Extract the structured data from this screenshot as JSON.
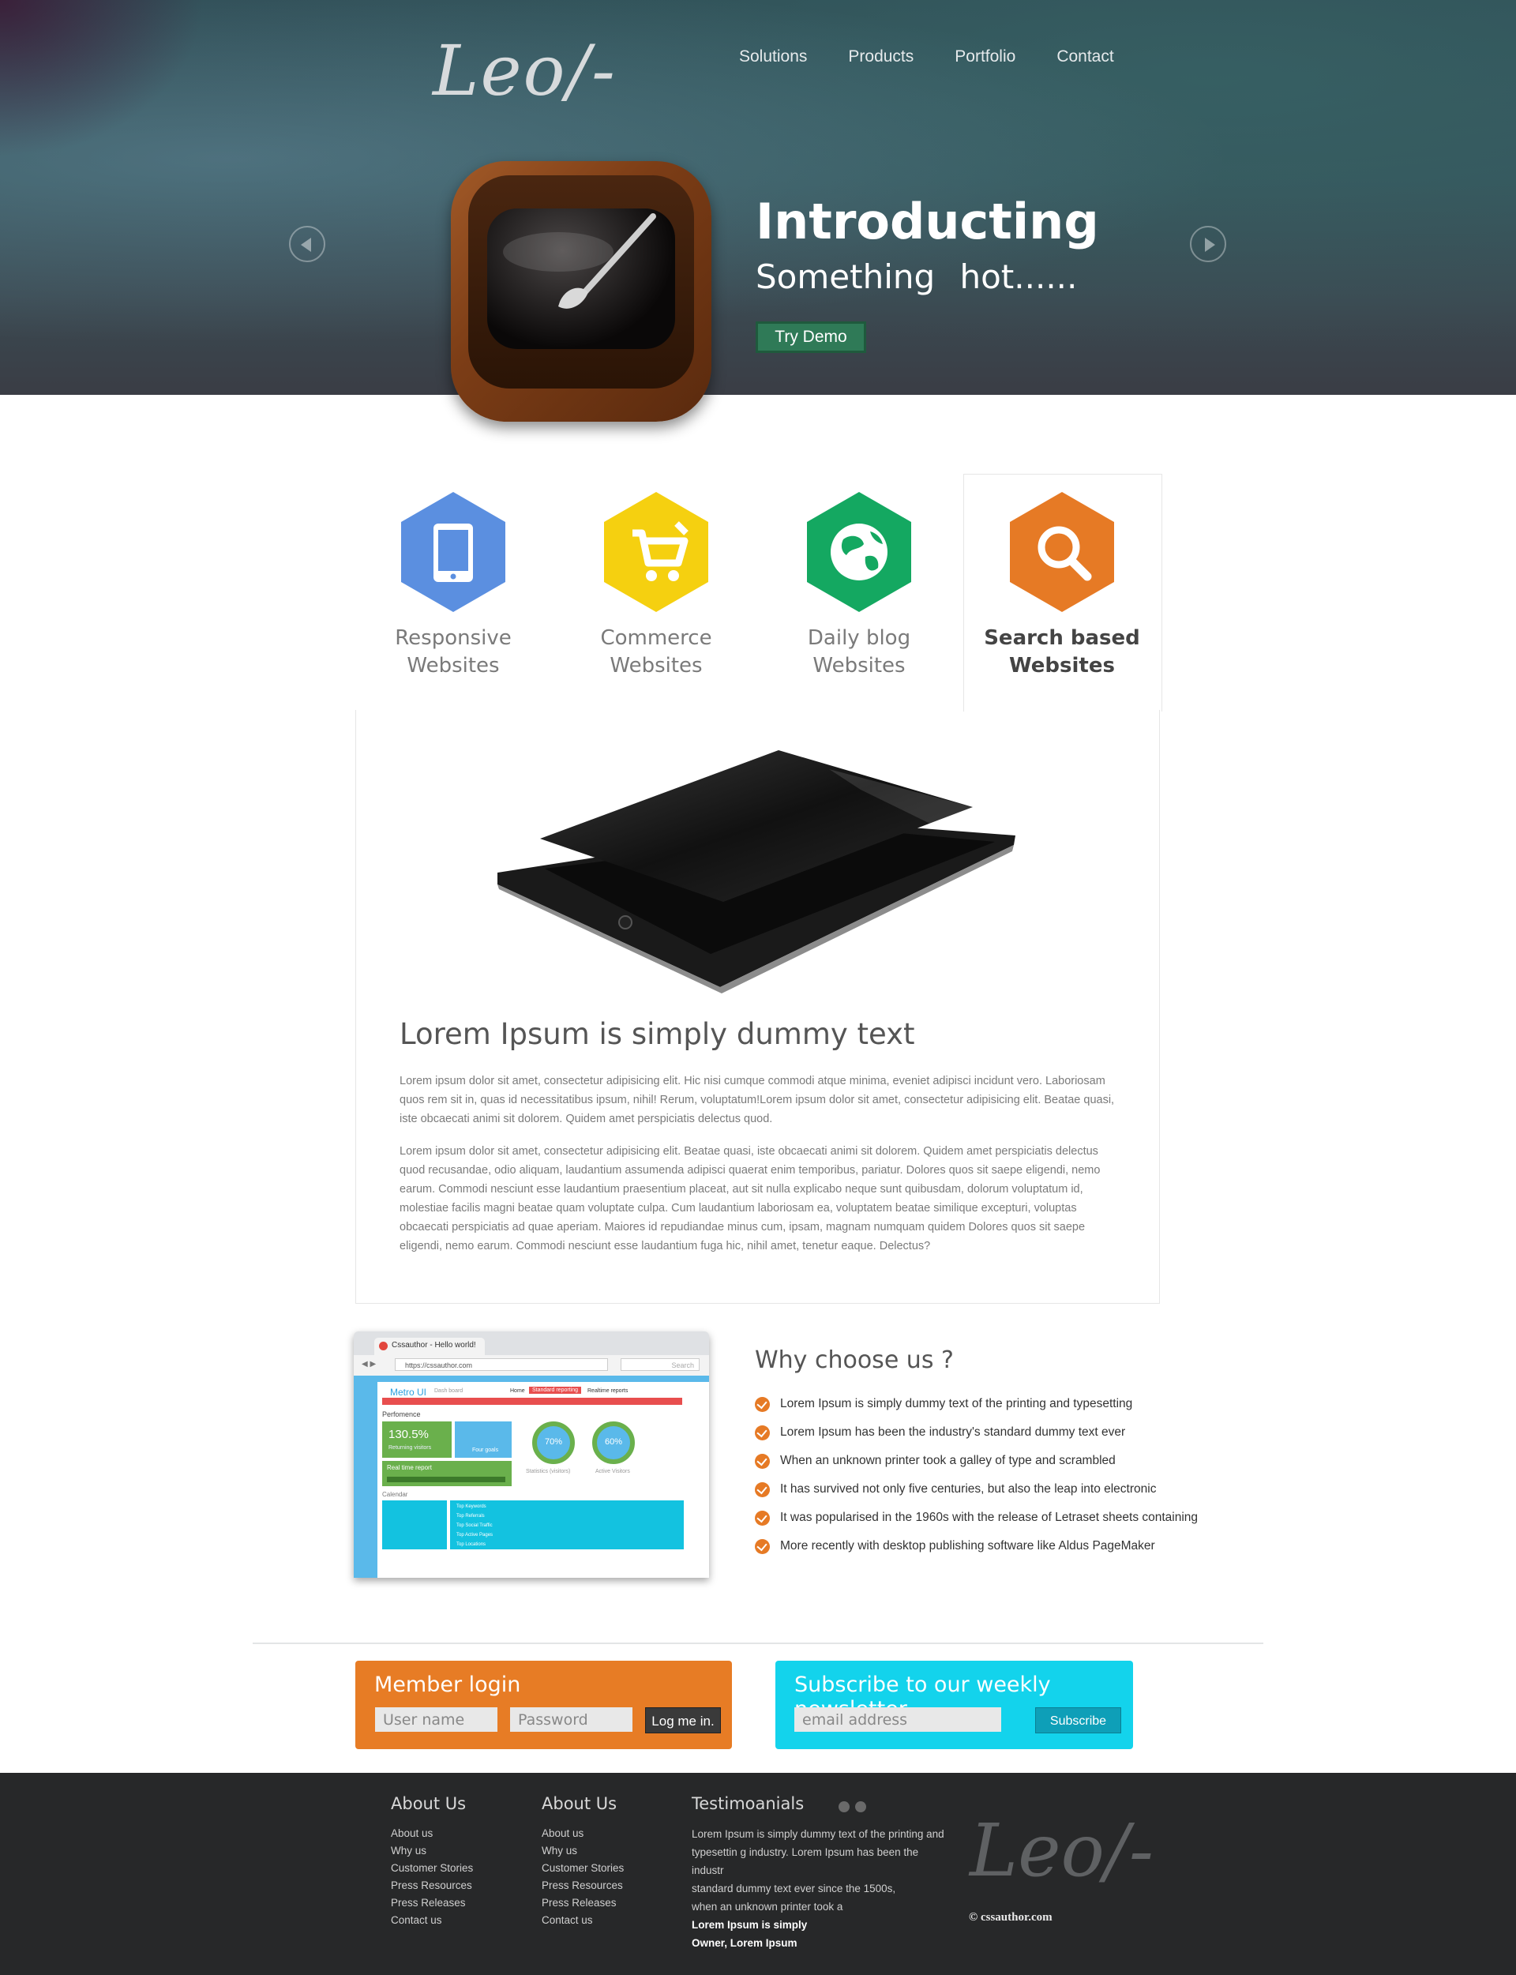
{
  "header": {
    "logo": "Leo/-",
    "nav": [
      "Solutions",
      "Products",
      "Portfolio",
      "Contact"
    ]
  },
  "hero": {
    "title": "Introducting",
    "subtitle": "Something   hot......",
    "cta": "Try Demo"
  },
  "features": [
    {
      "label": "Responsive Websites",
      "icon": "smartphone-icon",
      "color": "#5b8fe0"
    },
    {
      "label": "Commerce Websites",
      "icon": "shopping-cart-icon",
      "color": "#f5d010"
    },
    {
      "label": "Daily blog Websites",
      "icon": "globe-icon",
      "color": "#14a861"
    },
    {
      "label": "Search based Websites",
      "icon": "search-icon",
      "color": "#e67a25",
      "active": true
    }
  ],
  "content": {
    "title": "Lorem Ipsum is simply dummy text",
    "p1": "Lorem ipsum dolor sit amet, consectetur adipisicing elit. Hic nisi cumque commodi atque minima, eveniet adipisci incidunt vero. Laboriosam quos rem sit in, quas id necessitatibus ipsum, nihil! Rerum, voluptatum!Lorem ipsum dolor sit amet, consectetur adipisicing elit. Beatae quasi, iste obcaecati animi sit dolorem. Quidem amet perspiciatis delectus quod.",
    "p2": "Lorem ipsum dolor sit amet, consectetur adipisicing elit. Beatae quasi, iste obcaecati animi sit dolorem. Quidem amet perspiciatis delectus quod recusandae, odio aliquam, laudantium assumenda adipisci quaerat enim temporibus, pariatur. Dolores quos sit saepe eligendi, nemo earum. Commodi nesciunt esse laudantium praesentium placeat, aut sit nulla explicabo neque sunt quibusdam, dolorum voluptatum id, molestiae facilis magni beatae quam voluptate culpa. Cum laudantium laboriosam ea, voluptatem beatae similique excepturi, voluptas obcaecati perspiciatis ad quae aperiam. Maiores id repudiandae minus cum, ipsam, magnam numquam quidem Dolores quos sit saepe eligendi, nemo earum. Commodi nesciunt esse laudantium fuga hic, nihil amet, tenetur eaque. Delectus?"
  },
  "browser": {
    "tab": "Cssauthor -  Hello world!",
    "url": "https://cssauthor.com",
    "search": "Search",
    "app_title": "Metro UI",
    "app_subtitle": "Dash board",
    "nav": [
      "Home",
      "Standard reporting",
      "Realtime reports"
    ],
    "section": "Perfomence",
    "stat1": "130.5%",
    "stat1_label": "Returning visitors",
    "stat2_label": "Four goals",
    "realtime": "Real time report",
    "ring1": "70%",
    "ring1_label": "Statistics (visitors)",
    "ring2": "60%",
    "ring2_label": "Active Visitors",
    "calendar": "Calendar",
    "rows": [
      "Top Keywords",
      "Top Referrals",
      "Top Social Traffic",
      "Top Active Pages",
      "Top Locations"
    ]
  },
  "why": {
    "title": "Why choose us ?",
    "items": [
      "Lorem Ipsum is simply dummy text of the printing and typesetting",
      "Lorem Ipsum has been the industry's standard dummy text ever",
      "When an unknown printer took a galley of type and scrambled",
      "It has survived not only five centuries, but also the leap into electronic",
      "It was popularised in the 1960s with the release of Letraset sheets containing",
      "More recently with desktop publishing software like Aldus PageMaker"
    ]
  },
  "login": {
    "title": "Member login",
    "username_placeholder": "User name",
    "password_placeholder": "Password",
    "button": "Log me in."
  },
  "newsletter": {
    "title": "Subscribe to our weekly newsletter",
    "email_placeholder": "email address",
    "button": "Subscribe"
  },
  "footer": {
    "col1": {
      "title": "About Us",
      "links": [
        "About us",
        "Why us",
        "Customer Stories",
        "Press Resources",
        "Press Releases",
        "Contact us"
      ]
    },
    "col2": {
      "title": "About Us",
      "links": [
        "About us",
        "Why us",
        "Customer Stories",
        "Press Resources",
        "Press Releases",
        "Contact us"
      ]
    },
    "testimonials": {
      "title": "Testimoanials",
      "lines": [
        "Lorem Ipsum is simply dummy text of the printing and",
        "typesettin g industry. Lorem Ipsum has been the industr",
        "standard dummy text ever since the 1500s,",
        "when an unknown printer took a"
      ],
      "quote": "Lorem Ipsum is simply",
      "author": "Owner, Lorem Ipsum"
    },
    "logo": "Leo/-",
    "copyright": "© cssauthor.com"
  },
  "colors": {
    "orange": "#e67a25",
    "cyan": "#13d3ec",
    "green": "#2f7a57",
    "footer_bg": "#272829"
  }
}
